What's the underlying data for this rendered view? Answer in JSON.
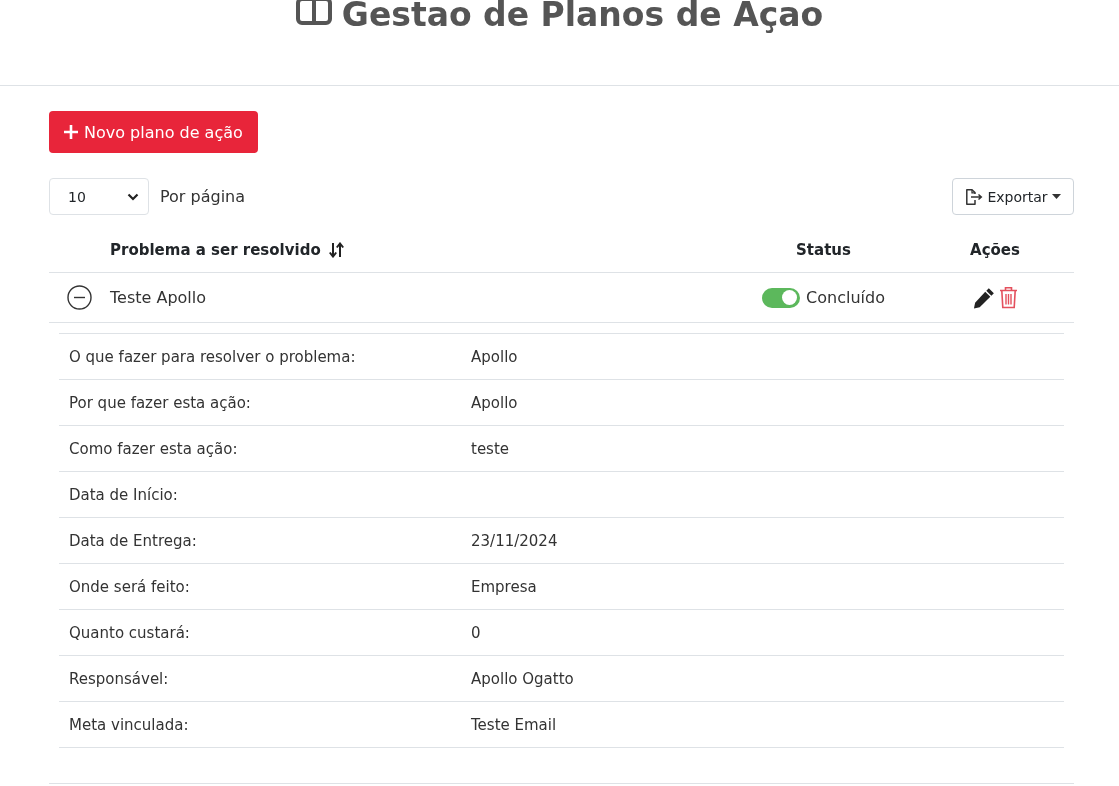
{
  "header": {
    "title": "Gestao de Planos de Açao"
  },
  "new_button": {
    "label": "Novo plano de ação"
  },
  "page_size": {
    "value": "10",
    "label": "Por página"
  },
  "export_button": {
    "label": "Exportar"
  },
  "table": {
    "columns": [
      {
        "label": "Problema a ser resolvido",
        "sortable": true
      },
      {
        "label": "Status",
        "sortable": false
      },
      {
        "label": "Ações",
        "sortable": false
      }
    ],
    "rows": [
      {
        "problem": "Teste Apollo",
        "expanded": true,
        "status_on": true,
        "status": "Concluído",
        "details": [
          {
            "label": "O que fazer para resolver o problema:",
            "value": "Apollo"
          },
          {
            "label": "Por que fazer esta ação:",
            "value": "Apollo"
          },
          {
            "label": "Como fazer esta ação:",
            "value": "teste"
          },
          {
            "label": "Data de Início:"
          },
          {
            "label": "Data de Entrega:",
            "value": "23/11/2024"
          },
          {
            "label": "Onde será feito:",
            "value": "Empresa"
          },
          {
            "label": "Quanto custará:",
            "value": "0"
          },
          {
            "label": "Responsável:",
            "value": "Apollo Ogatto"
          },
          {
            "label": "Meta vinculada:",
            "value": "Teste Email"
          }
        ]
      }
    ]
  }
}
